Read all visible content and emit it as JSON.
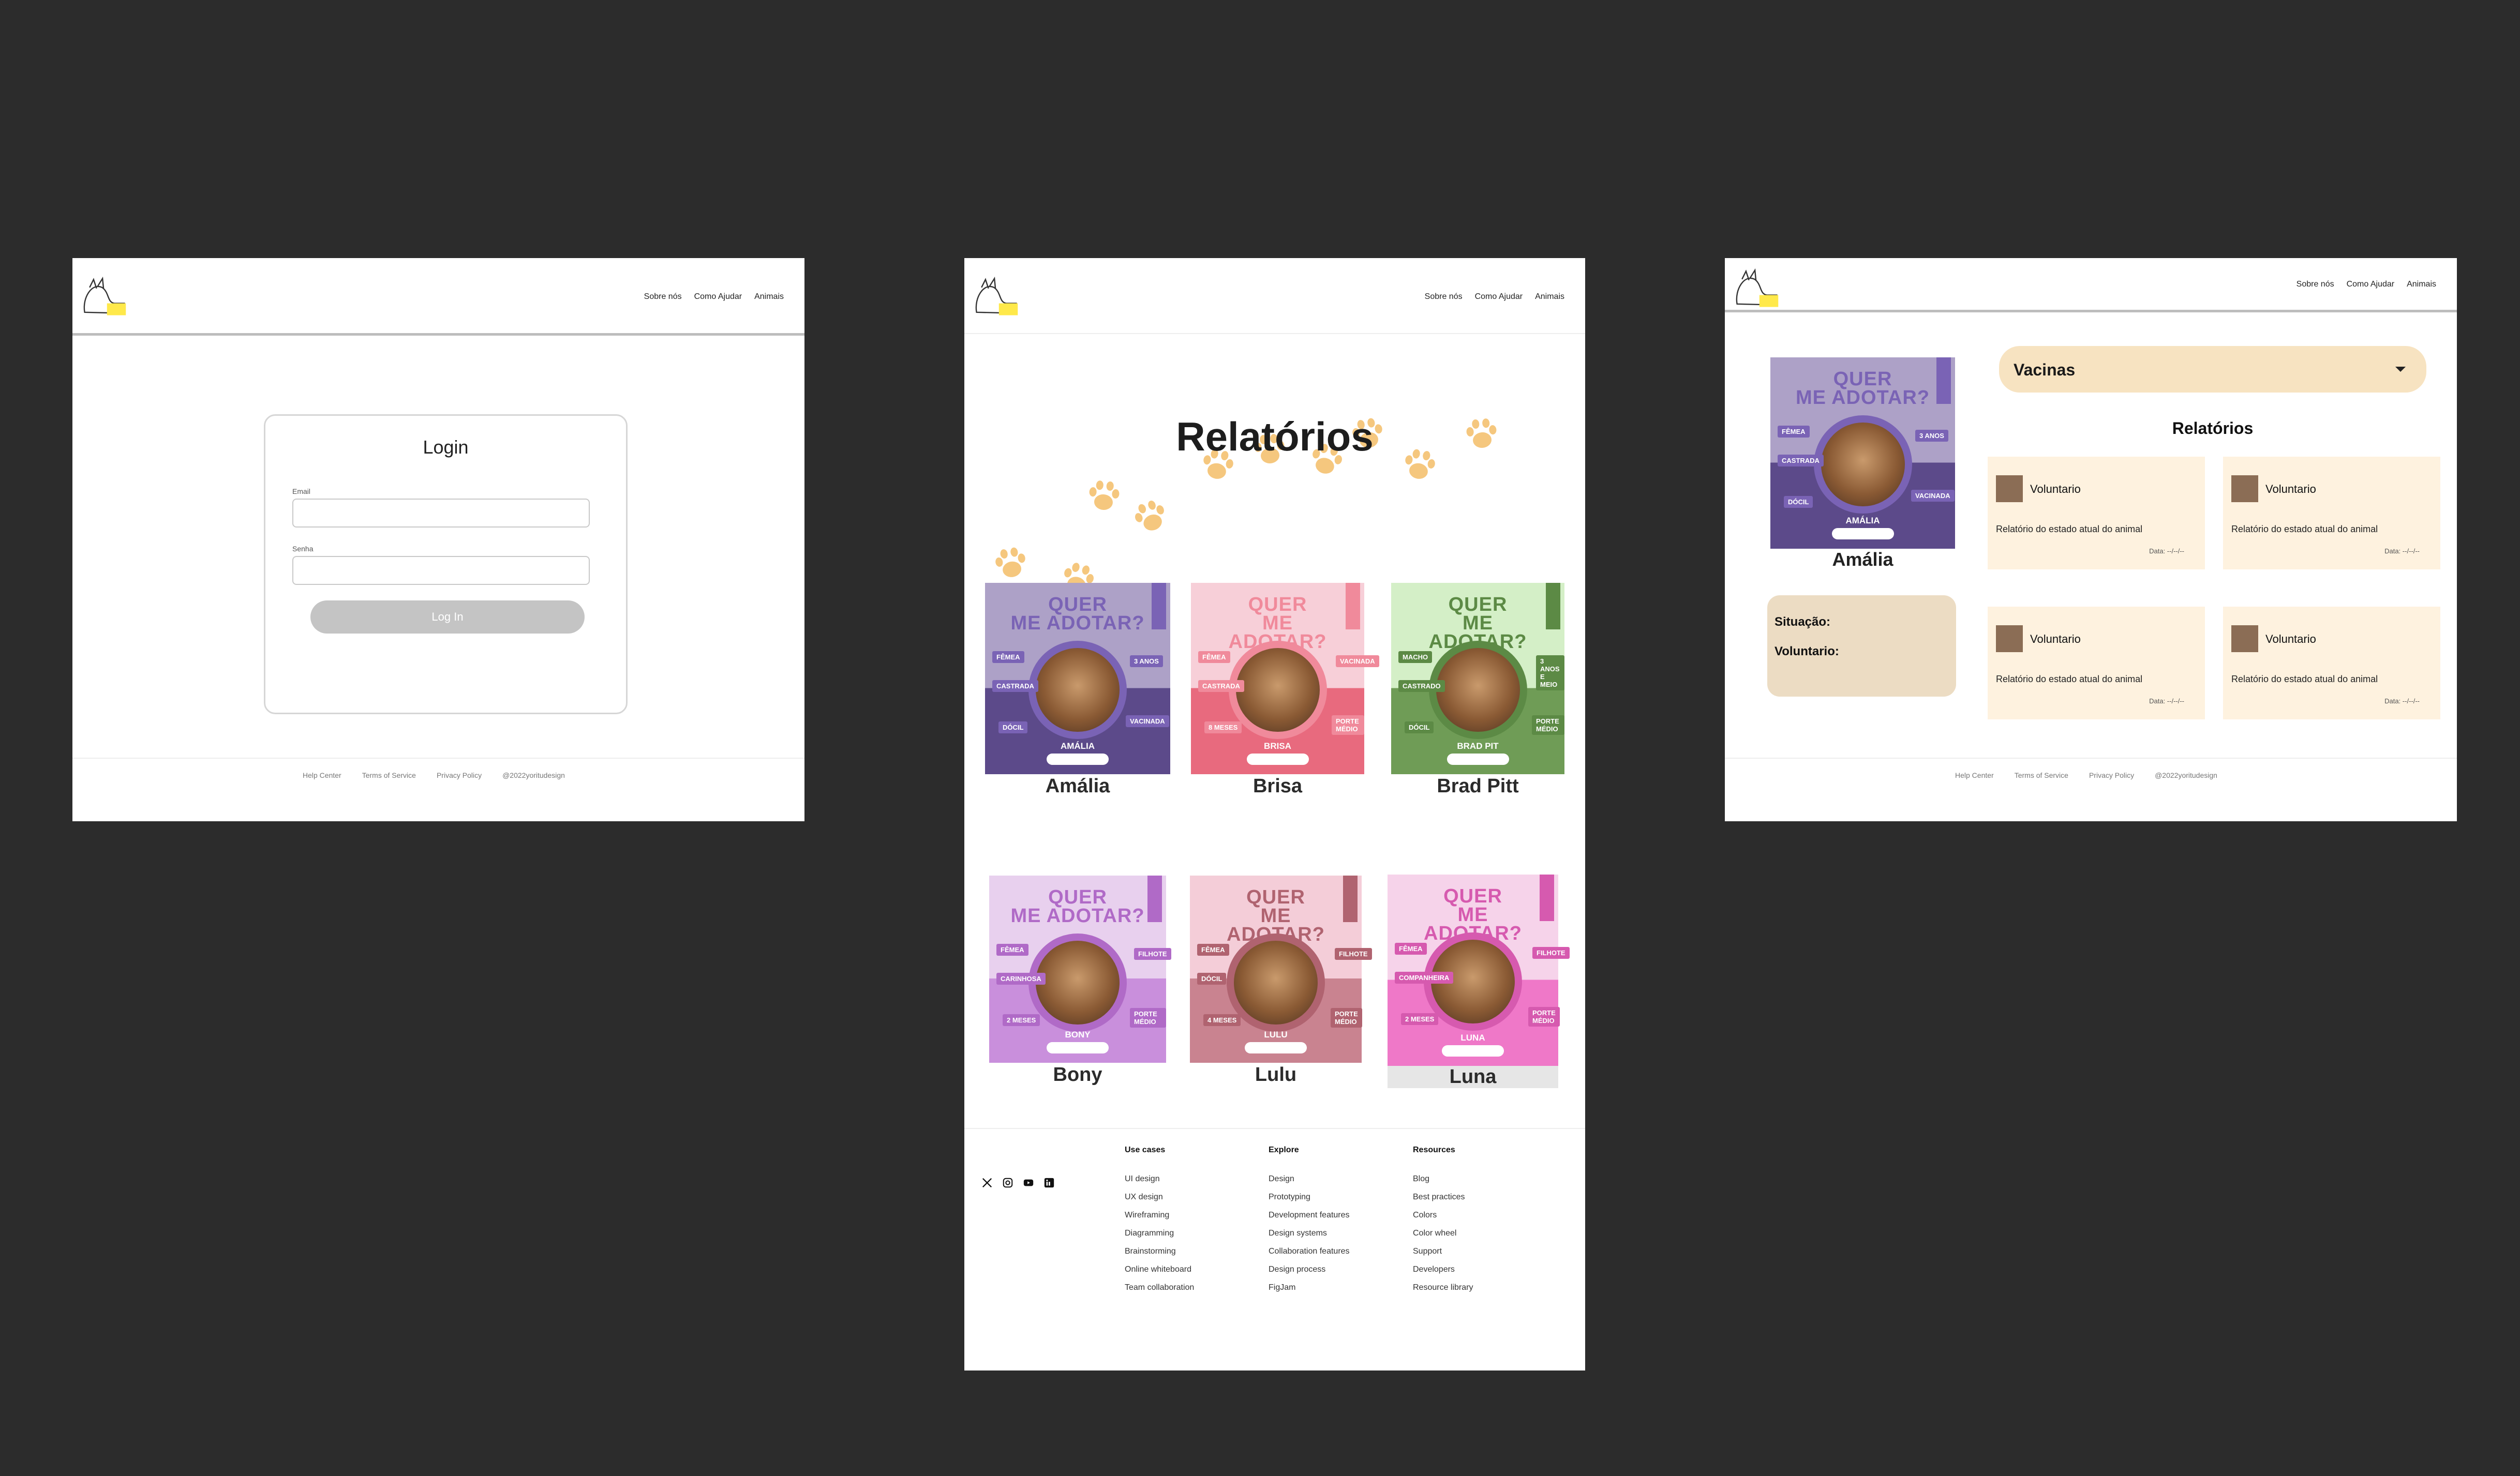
{
  "nav": [
    "Sobre nós",
    "Como Ajudar",
    "Animais"
  ],
  "login": {
    "title": "Login",
    "email_label": "Email",
    "password_label": "Senha",
    "button": "Log In"
  },
  "small_footer": [
    "Help Center",
    "Terms of Service",
    "Privacy Policy",
    "@2022yoritudesign"
  ],
  "reports": {
    "title": "Relatórios",
    "poster_head": [
      "QUER",
      "ME ADOTAR?"
    ],
    "animals": [
      {
        "name": "Amália",
        "poster_name": "AMÁLIA",
        "tags": [
          "FÊMEA",
          "3 ANOS",
          "CASTRADA",
          "DÓCIL",
          "VACINADA"
        ],
        "bg": "#ada1c7",
        "dark": "#5c4a8a",
        "accent": "#7a63b5"
      },
      {
        "name": "Brisa",
        "poster_name": "BRISA",
        "tags": [
          "FÊMEA",
          "VACINADA",
          "CASTRADA",
          "8 MESES",
          "PORTE MÉDIO"
        ],
        "bg": "#f7cfd8",
        "dark": "#e86a7e",
        "accent": "#f08a9b"
      },
      {
        "name": "Brad Pitt",
        "poster_name": "BRAD PIT",
        "tags": [
          "MACHO",
          "3 ANOS E MEIO",
          "CASTRADO",
          "DÓCIL",
          "PORTE MÉDIO"
        ],
        "bg": "#d4efc7",
        "dark": "#6f9c56",
        "accent": "#5c8a45"
      },
      {
        "name": "Bony",
        "poster_name": "BONY",
        "tags": [
          "FÊMEA",
          "FILHOTE",
          "CARINHOSA",
          "2 MESES",
          "PORTE MÉDIO"
        ],
        "bg": "#e8d0ee",
        "dark": "#c98fdc",
        "accent": "#b06ac7"
      },
      {
        "name": "Lulu",
        "poster_name": "LULU",
        "tags": [
          "FÊMEA",
          "FILHOTE",
          "DÓCIL",
          "4 MESES",
          "PORTE MÉDIO"
        ],
        "bg": "#f4cdd8",
        "dark": "#c98390",
        "accent": "#b06370"
      },
      {
        "name": "Luna",
        "poster_name": "LUNA",
        "tags": [
          "FÊMEA",
          "FILHOTE",
          "COMPANHEIRA",
          "2 MESES",
          "PORTE MÉDIO"
        ],
        "bg": "#f6d3ea",
        "dark": "#ef78c8",
        "accent": "#d65aaf"
      }
    ]
  },
  "big_footer": {
    "columns": [
      {
        "title": "Use cases",
        "items": [
          "UI design",
          "UX design",
          "Wireframing",
          "Diagramming",
          "Brainstorming",
          "Online whiteboard",
          "Team collaboration"
        ]
      },
      {
        "title": "Explore",
        "items": [
          "Design",
          "Prototyping",
          "Development features",
          "Design systems",
          "Collaboration features",
          "Design process",
          "FigJam"
        ]
      },
      {
        "title": "Resources",
        "items": [
          "Blog",
          "Best practices",
          "Colors",
          "Color wheel",
          "Support",
          "Developers",
          "Resource library"
        ]
      }
    ],
    "social_icons": [
      "x-icon",
      "instagram-icon",
      "youtube-icon",
      "linkedin-icon"
    ]
  },
  "detail": {
    "animal_name": "Amália",
    "situacao_label": "Situação:",
    "voluntario_label": "Voluntario:",
    "vacinas_label": "Vacinas",
    "relatorios_title": "Relatórios",
    "reports": [
      {
        "author": "Voluntario",
        "text": "Relatório do estado atual do animal",
        "date": "Data: --/--/--"
      },
      {
        "author": "Voluntario",
        "text": "Relatório do estado atual do animal",
        "date": "Data: --/--/--"
      },
      {
        "author": "Voluntario",
        "text": "Relatório do estado atual do animal",
        "date": "Data: --/--/--"
      },
      {
        "author": "Voluntario",
        "text": "Relatório do estado atual do animal",
        "date": "Data: --/--/--"
      }
    ]
  },
  "colors": {
    "paw": "#f5c77e",
    "vacinas_bg": "#f7e3c1",
    "situacao_bg": "#ecdcc3",
    "report_card_bg": "#fef2df"
  }
}
